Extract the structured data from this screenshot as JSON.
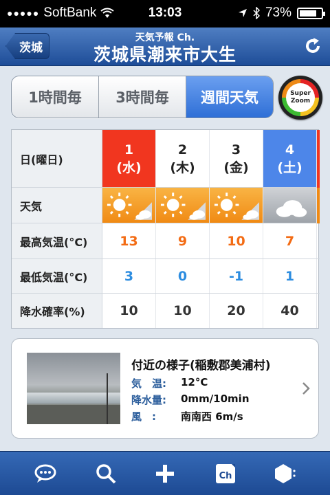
{
  "status_bar": {
    "carrier": "SoftBank",
    "time": "13:03",
    "battery": "73%"
  },
  "nav": {
    "back_label": "茨城",
    "subtitle": "天気予報 Ch.",
    "title": "茨城県潮来市大生"
  },
  "segments": {
    "hourly": "1時間毎",
    "three_hour": "3時間毎",
    "weekly": "週間天気"
  },
  "zoom_button": {
    "line1": "Super",
    "line2": "Zoom"
  },
  "forecast": {
    "labels": {
      "day": "日(曜日)",
      "weather": "天気",
      "high": "最高気温(°C)",
      "low": "最低気温(°C)",
      "rain": "降水確率(%)"
    },
    "days": [
      {
        "num": "1",
        "dow": "(水)",
        "weather": "sunny-then-cloudy",
        "high": "13",
        "low": "3",
        "rain": "10"
      },
      {
        "num": "2",
        "dow": "(木)",
        "weather": "sunny-then-cloudy",
        "high": "9",
        "low": "0",
        "rain": "10"
      },
      {
        "num": "3",
        "dow": "(金)",
        "weather": "sunny-then-cloudy",
        "high": "10",
        "low": "-1",
        "rain": "20"
      },
      {
        "num": "4",
        "dow": "(土)",
        "weather": "cloudy",
        "high": "7",
        "low": "1",
        "rain": "40"
      }
    ],
    "colors": {
      "wednesday": "#f1361f",
      "saturday": "#4d86e9"
    }
  },
  "nearby": {
    "title": "付近の様子(稲敷郡美浦村)",
    "temp_key": "気　温:",
    "temp_val": "12°C",
    "precip_key": "降水量:",
    "precip_val": "0mm/10min",
    "wind_key": "風　:",
    "wind_val": "南南西 6m/s"
  },
  "tabbar": {
    "icons": [
      "chat-icon",
      "search-icon",
      "add-icon",
      "channel-icon",
      "settings-icon"
    ]
  }
}
